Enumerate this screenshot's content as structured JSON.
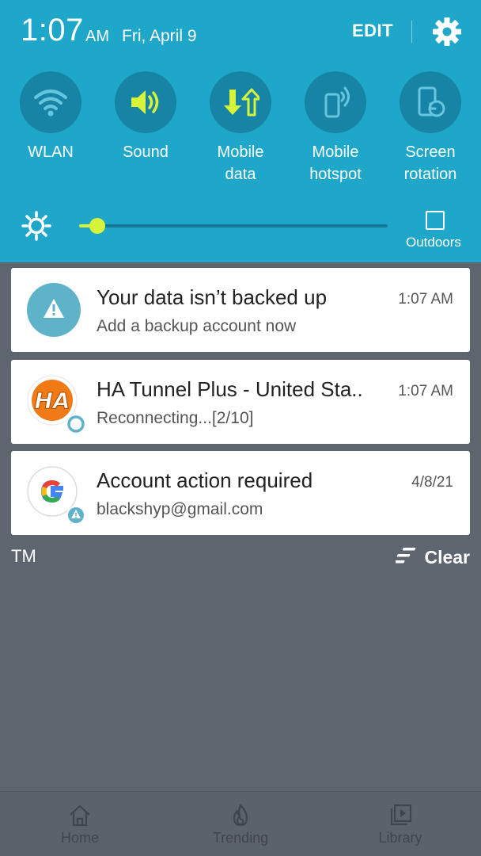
{
  "status": {
    "time": "1:07",
    "ampm": "AM",
    "date": "Fri, April 9",
    "edit_label": "EDIT"
  },
  "tiles": [
    {
      "label_line1": "WLAN",
      "label_line2": "",
      "icon": "wifi-icon"
    },
    {
      "label_line1": "Sound",
      "label_line2": "",
      "icon": "speaker-icon"
    },
    {
      "label_line1": "Mobile",
      "label_line2": "data",
      "icon": "mobile-data-icon"
    },
    {
      "label_line1": "Mobile",
      "label_line2": "hotspot",
      "icon": "hotspot-icon"
    },
    {
      "label_line1": "Screen",
      "label_line2": "rotation",
      "icon": "screen-rotation-icon"
    }
  ],
  "brightness": {
    "level": 0.06,
    "outdoors_label": "Outdoors"
  },
  "notifications": [
    {
      "title": "Your data isn’t backed up",
      "subtitle": "Add a backup account now",
      "time": "1:07 AM",
      "icon": "warning-icon"
    },
    {
      "title": "HA Tunnel Plus - United Sta..",
      "subtitle": "Reconnecting...[2/10]",
      "time": "1:07 AM",
      "icon": "ha-tunnel-app-icon"
    },
    {
      "title": "Account action required",
      "subtitle": "blackshyp@gmail.com",
      "time": "4/8/21",
      "icon": "google-icon"
    }
  ],
  "carrier_label": "TM",
  "clear_label": "Clear",
  "nav": {
    "home_label": "Home",
    "trending_label": "Trending",
    "library_label": "Library"
  },
  "colors": {
    "panel": "#1ea7c9",
    "tile_circle": "#1784a6",
    "active_accent": "#d8f43a",
    "shade_background": "#5d656f"
  }
}
